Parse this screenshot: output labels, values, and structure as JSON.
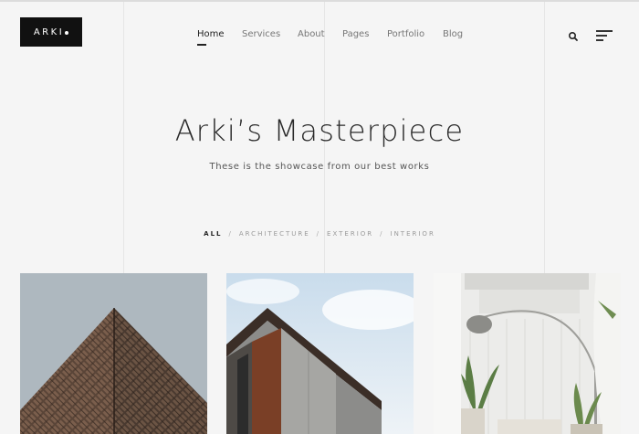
{
  "logo": {
    "text": "ARKI"
  },
  "nav": {
    "items": [
      {
        "label": "Home",
        "active": true
      },
      {
        "label": "Services"
      },
      {
        "label": "About"
      },
      {
        "label": "Pages"
      },
      {
        "label": "Portfolio"
      },
      {
        "label": "Blog"
      }
    ]
  },
  "hero": {
    "title": "Arki’s Masterpiece",
    "subtitle": "These is the showcase from our best works"
  },
  "filters": {
    "items": [
      "ALL",
      "ARCHITECTURE",
      "EXTERIOR",
      "INTERIOR"
    ],
    "separator": "/",
    "active": "ALL"
  },
  "portfolio": {
    "cards": [
      {
        "image": "triangular-building-facade"
      },
      {
        "image": "modern-building-corner"
      },
      {
        "image": "white-interior-plants"
      }
    ]
  },
  "colors": {
    "background": "#f5f5f5",
    "text": "#222222",
    "logo_bg": "#111111"
  }
}
